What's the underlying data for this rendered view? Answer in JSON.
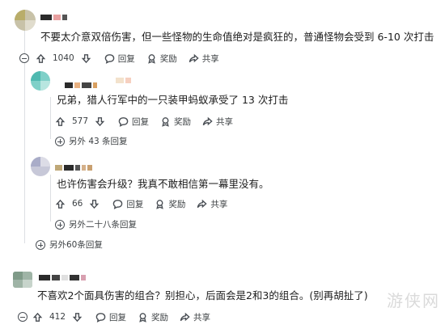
{
  "comments": [
    {
      "text": "不要太介意双倍伤害，但一些怪物的生命值绝对是疯狂的，普通怪物会受到 6-10 次打击",
      "votes": "1040",
      "reply_label": "回复",
      "award_label": "奖励",
      "share_label": "共享"
    },
    {
      "text": "兄弟，猎人行军中的一只装甲蚂蚁承受了 13 次打击",
      "votes": "577",
      "reply_label": "回复",
      "award_label": "奖励",
      "share_label": "共享",
      "more_replies": "另外 43 条回复"
    },
    {
      "text": "也许伤害会升级？我真不敢相信第一幕里没有。",
      "votes": "66",
      "reply_label": "回复",
      "award_label": "奖励",
      "share_label": "共享",
      "more_replies": "另外二十八条回复"
    },
    {
      "text": "不喜欢2个面具伤害的组合？别担心，后面会是2和3的组合。(别再胡扯了)",
      "votes": "412",
      "reply_label": "回复",
      "award_label": "奖励",
      "share_label": "共享"
    }
  ],
  "thread_more_replies": "另外60条回复",
  "watermark": "游侠网",
  "icons": {
    "upvote": "arrow-up-icon",
    "downvote": "arrow-down-icon",
    "reply": "speech-bubble-icon",
    "award": "award-icon",
    "share": "share-arrow-icon",
    "collapse": "minus-circle-icon",
    "expand": "plus-circle-icon"
  }
}
